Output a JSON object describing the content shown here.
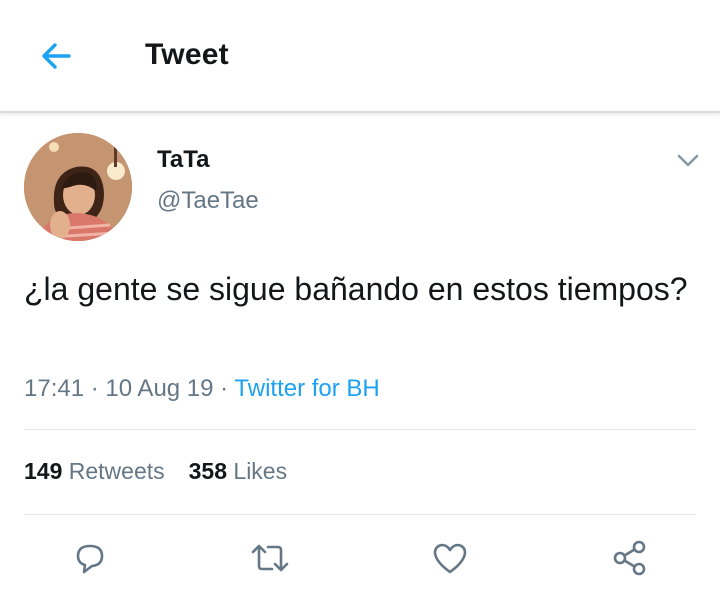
{
  "header": {
    "back_icon": "arrow-left-icon",
    "title": "Tweet"
  },
  "colors": {
    "accent": "#1da1f2",
    "text_primary": "#14171a",
    "text_secondary": "#657786",
    "divider": "#e1e8ed"
  },
  "tweet": {
    "author_name": "TaTa",
    "author_handle": "@TaeTae",
    "text": "¿la gente se sigue bañando en estos tiempos?",
    "time": "17:41",
    "sep1": " · ",
    "date": "10 Aug 19",
    "sep2": " · ",
    "source": "Twitter for BH",
    "menu_icon": "chevron-down-icon"
  },
  "stats": {
    "retweets_count": "149",
    "retweets_label": "Retweets",
    "likes_count": "358",
    "likes_label": "Likes"
  },
  "actions": [
    {
      "icon": "reply-icon"
    },
    {
      "icon": "retweet-icon"
    },
    {
      "icon": "like-icon"
    },
    {
      "icon": "share-icon"
    }
  ]
}
